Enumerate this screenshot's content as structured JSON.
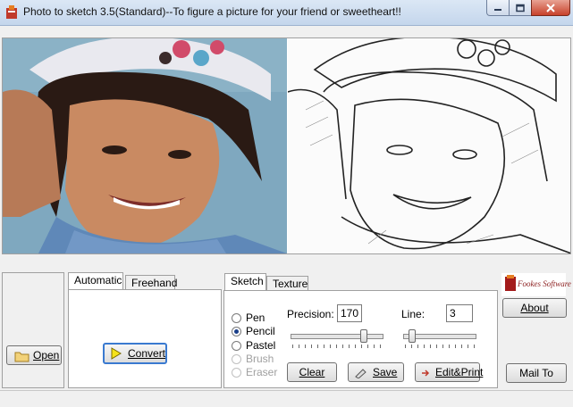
{
  "window": {
    "title": "Photo to sketch 3.5(Standard)--To figure a picture for your friend or sweetheart!!",
    "buttons": [
      "minimize",
      "maximize",
      "close"
    ]
  },
  "toolbar": {
    "open_label": "Open",
    "open_icon": "folder-icon"
  },
  "automatic_panel": {
    "tabs": [
      "Automatic",
      "Freehand"
    ],
    "active_tab": "Automatic",
    "convert_label": "Convert",
    "convert_icon": "play-triangle-icon"
  },
  "sketch_panel": {
    "tabs": [
      "Sketch",
      "Texture"
    ],
    "active_tab": "Sketch",
    "tools": [
      {
        "label": "Pen",
        "selected": false,
        "enabled": true
      },
      {
        "label": "Pencil",
        "selected": true,
        "enabled": true
      },
      {
        "label": "Pastel",
        "selected": false,
        "enabled": true
      },
      {
        "label": "Brush",
        "selected": false,
        "enabled": false
      },
      {
        "label": "Eraser",
        "selected": false,
        "enabled": false
      }
    ],
    "precision_label": "Precision:",
    "precision_value": "170",
    "precision_slider_fraction": 0.8,
    "line_label": "Line:",
    "line_value": "3",
    "line_slider_fraction": 0.1,
    "clear_label": "Clear",
    "save_label": "Save",
    "editprint_label": "Edit&Print"
  },
  "right_panel": {
    "about_label": "About",
    "mailto_label": "Mail To",
    "logo_text": "Fookes Software"
  },
  "colors": {
    "titlebar": "#c4d6ec",
    "close_button": "#c7412a",
    "window_bg": "#f0f0f0"
  }
}
